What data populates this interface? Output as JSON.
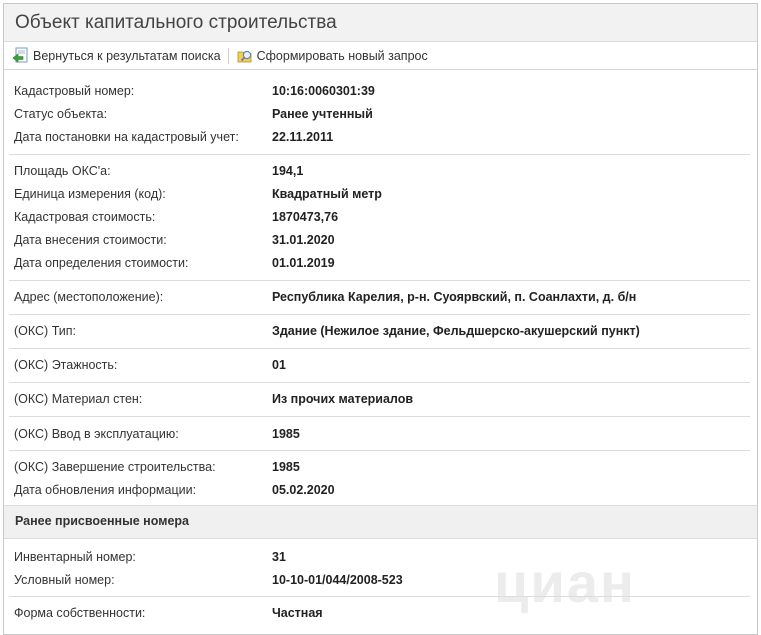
{
  "header": {
    "title": "Объект капитального строительства"
  },
  "toolbar": {
    "back_label": "Вернуться к результатам поиска",
    "new_request_label": "Сформировать новый запрос"
  },
  "fields": {
    "cadastral_number": {
      "label": "Кадастровый номер:",
      "value": "10:16:0060301:39"
    },
    "status": {
      "label": "Статус объекта:",
      "value": "Ранее учтенный"
    },
    "registration_date": {
      "label": "Дата постановки на кадастровый учет:",
      "value": "22.11.2011"
    },
    "area": {
      "label": "Площадь ОКС'а:",
      "value": "194,1"
    },
    "unit": {
      "label": "Единица измерения (код):",
      "value": "Квадратный метр"
    },
    "cadastral_value": {
      "label": "Кадастровая стоимость:",
      "value": "1870473,76"
    },
    "value_entry_date": {
      "label": "Дата внесения стоимости:",
      "value": "31.01.2020"
    },
    "value_determination_date": {
      "label": "Дата определения стоимости:",
      "value": "01.01.2019"
    },
    "address": {
      "label": "Адрес (местоположение):",
      "value": "Республика Карелия, р-н. Суоярвский, п. Соанлахти, д. б/н"
    },
    "type": {
      "label": "(ОКС) Тип:",
      "value": "Здание (Нежилое здание, Фельдшерско-акушерский пункт)"
    },
    "floors": {
      "label": "(ОКС) Этажность:",
      "value": "01"
    },
    "wall_material": {
      "label": "(ОКС) Материал стен:",
      "value": "Из прочих материалов"
    },
    "commissioning": {
      "label": "(ОКС) Ввод в эксплуатацию:",
      "value": "1985"
    },
    "construction_completion": {
      "label": "(ОКС) Завершение строительства:",
      "value": "1985"
    },
    "info_update_date": {
      "label": "Дата обновления информации:",
      "value": "05.02.2020"
    },
    "inventory_number": {
      "label": "Инвентарный номер:",
      "value": "31"
    },
    "conditional_number": {
      "label": "Условный номер:",
      "value": "10-10-01/044/2008-523"
    },
    "ownership_form": {
      "label": "Форма собственности:",
      "value": "Частная"
    }
  },
  "sections": {
    "previous_numbers": "Ранее присвоенные номера"
  },
  "watermark": {
    "text": "циан"
  }
}
